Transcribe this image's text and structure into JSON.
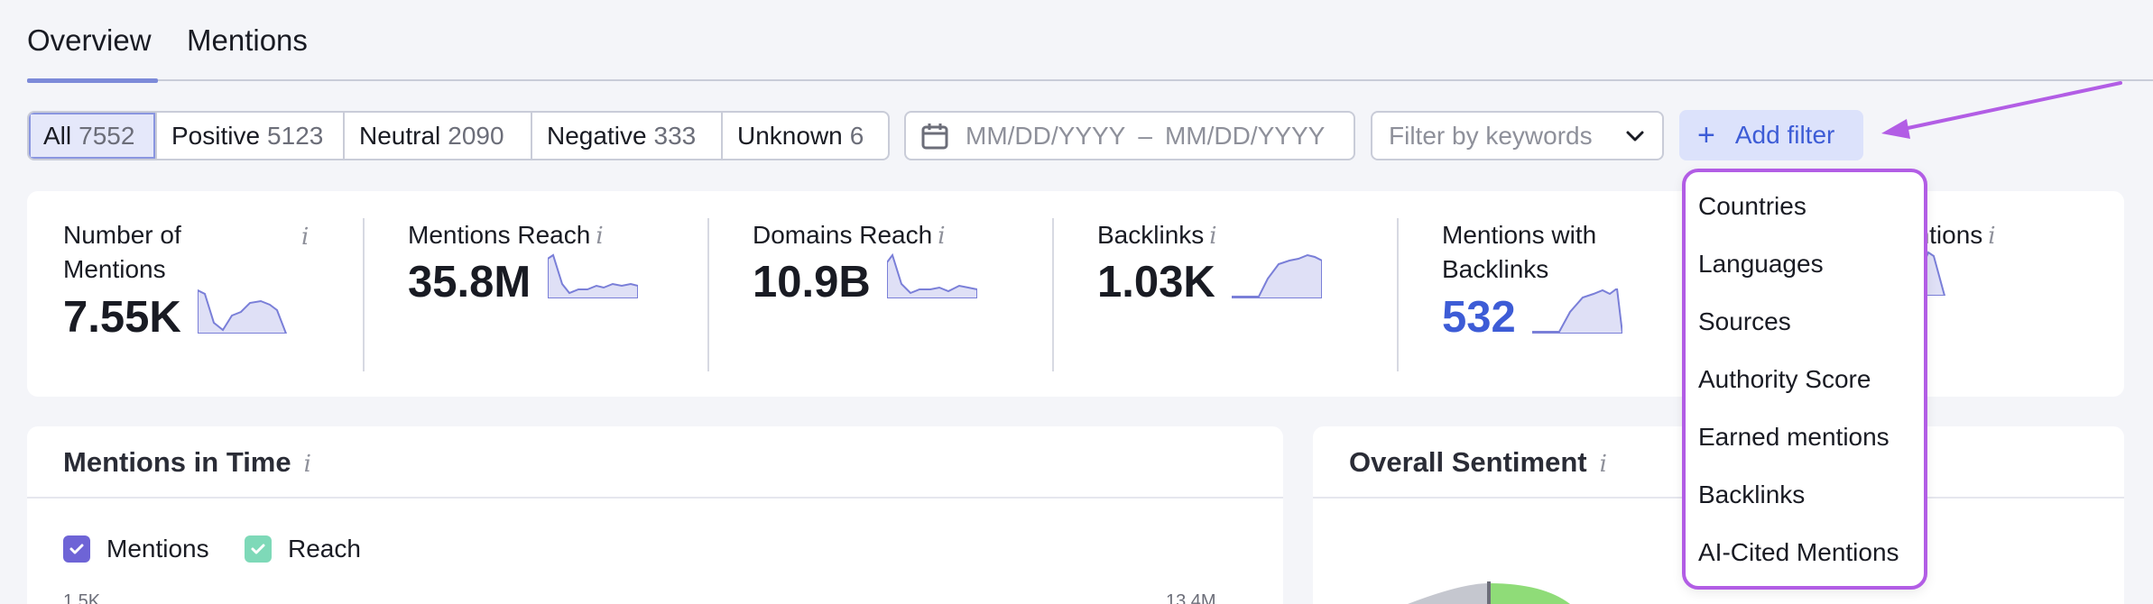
{
  "tabs": [
    {
      "label": "Overview",
      "active": true
    },
    {
      "label": "Mentions",
      "active": false
    }
  ],
  "sentiment_filter": [
    {
      "label": "All",
      "count": "7552",
      "active": true
    },
    {
      "label": "Positive",
      "count": "5123"
    },
    {
      "label": "Neutral",
      "count": "2090"
    },
    {
      "label": "Negative",
      "count": "333"
    },
    {
      "label": "Unknown",
      "count": "6"
    }
  ],
  "date_range": {
    "start_placeholder": "MM/DD/YYYY",
    "separator": "–",
    "end_placeholder": "MM/DD/YYYY",
    "icon": "calendar-icon"
  },
  "keyword_filter": {
    "placeholder": "Filter by keywords",
    "icon": "chevron-down-icon"
  },
  "add_filter": {
    "label": "Add filter",
    "icon": "plus-icon"
  },
  "metrics": [
    {
      "label_line1": "Number of",
      "label_line2": "Mentions",
      "info": "i",
      "value": "7.55K"
    },
    {
      "label": "Mentions Reach",
      "info": "i",
      "value": "35.8M"
    },
    {
      "label": "Domains Reach",
      "info": "i",
      "value": "10.9B"
    },
    {
      "label": "Backlinks",
      "info": "i",
      "value": "1.03K"
    },
    {
      "label_line1": "Mentions with",
      "label_line2": "Backlinks",
      "value": "532"
    },
    {
      "label_partial": "entions",
      "info": "i"
    }
  ],
  "cards": {
    "mentions_in_time": {
      "title": "Mentions in Time",
      "info": "i",
      "legend": [
        {
          "label": "Mentions",
          "color": "#6e64d6"
        },
        {
          "label": "Reach",
          "color": "#7ed9b8"
        }
      ],
      "y_left_top": "1.5K",
      "y_right_top": "13.4M"
    },
    "overall_sentiment": {
      "title": "Overall Sentiment",
      "info": "i"
    }
  },
  "filter_menu": [
    "Countries",
    "Languages",
    "Sources",
    "Authority Score",
    "Earned mentions",
    "Backlinks",
    "AI-Cited Mentions"
  ],
  "colors": {
    "accent": "#3d5cd6",
    "highlight_border": "#b25de5",
    "spark_fill": "#dfe0f6",
    "spark_line": "#7a7fd8"
  }
}
